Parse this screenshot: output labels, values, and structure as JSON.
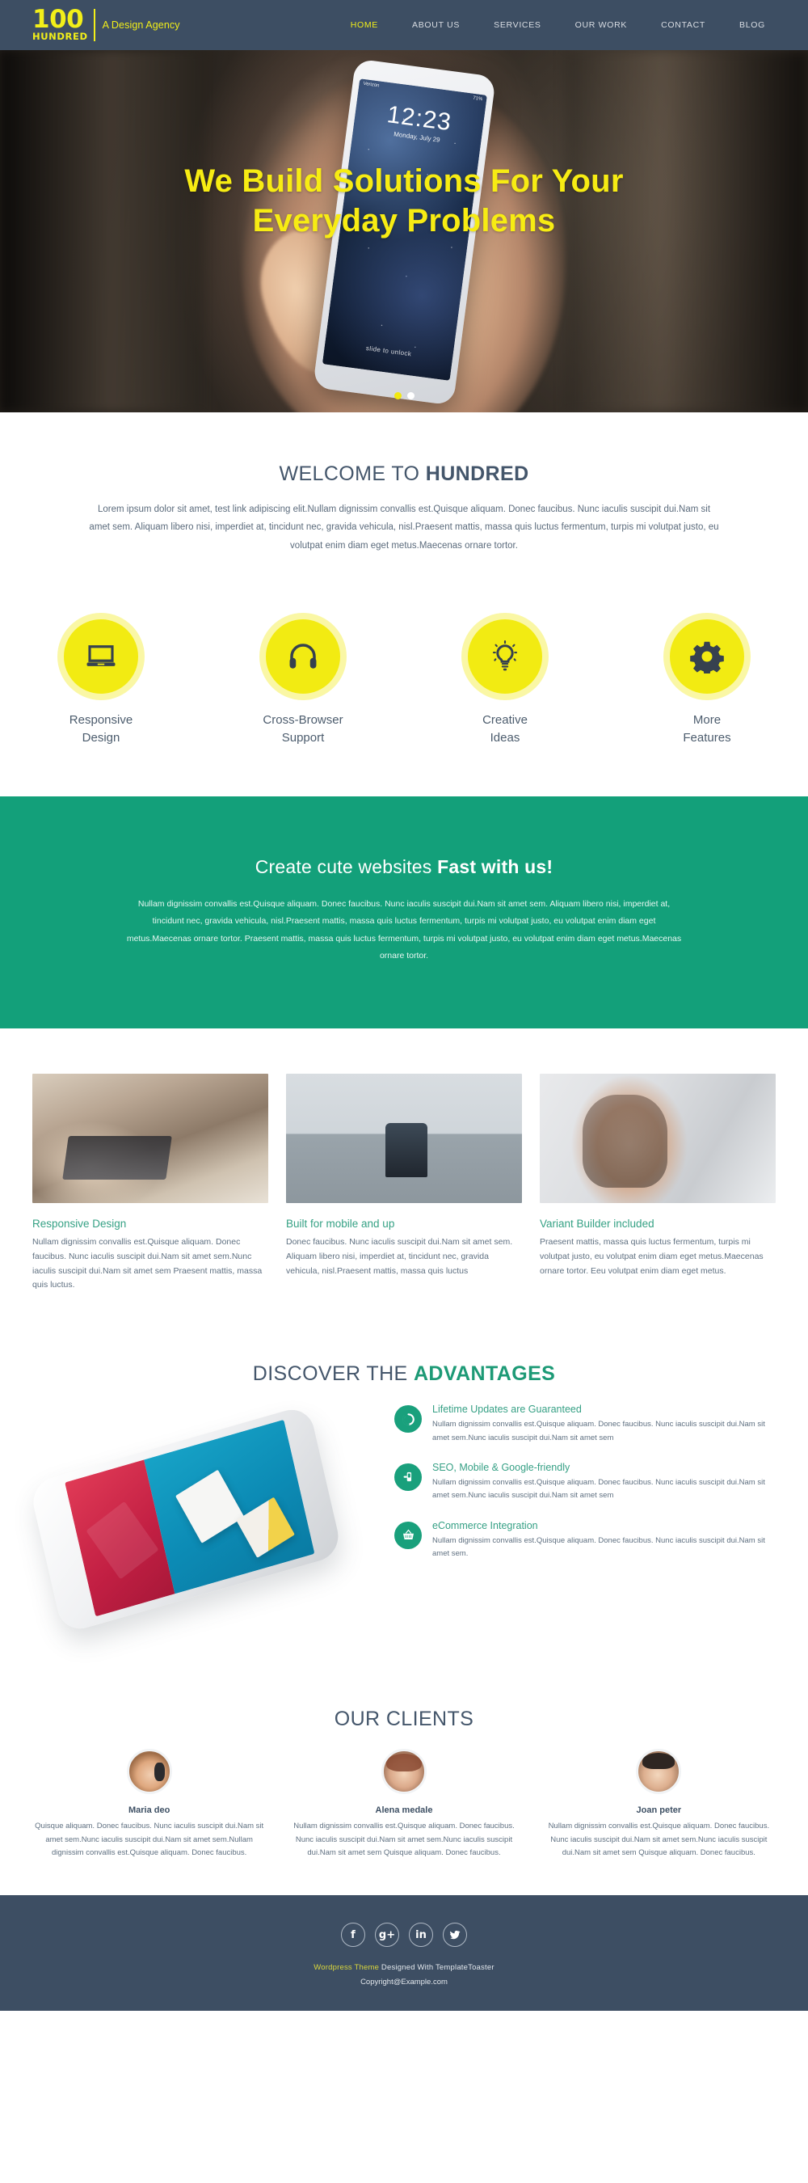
{
  "header": {
    "logo_number": "100",
    "logo_word": "HUNDRED",
    "tagline": "A Design Agency",
    "nav": [
      {
        "label": "HOME",
        "active": true
      },
      {
        "label": "ABOUT US",
        "active": false
      },
      {
        "label": "SERVICES",
        "active": false
      },
      {
        "label": "OUR WORK",
        "active": false
      },
      {
        "label": "CONTACT",
        "active": false
      },
      {
        "label": "BLOG",
        "active": false
      }
    ]
  },
  "hero": {
    "title_line1": "We Build Solutions For Your",
    "title_line2": "Everyday Problems",
    "phone": {
      "carrier": "Verizon",
      "time": "12:23",
      "date": "Monday, July 29",
      "battery": "71%",
      "unlock_text": "slide to unlock"
    },
    "dots": [
      {
        "active": true
      },
      {
        "active": false
      }
    ]
  },
  "welcome": {
    "title_normal": "WELCOME TO ",
    "title_bold": "HUNDRED",
    "copy": "Lorem ipsum dolor sit amet, test link adipiscing elit.Nullam dignissim convallis est.Quisque aliquam. Donec faucibus. Nunc iaculis suscipit dui.Nam sit amet sem. Aliquam libero nisi, imperdiet at, tincidunt nec, gravida vehicula, nisl.Praesent mattis, massa quis luctus fermentum, turpis mi volutpat justo, eu volutpat enim diam eget metus.Maecenas ornare tortor."
  },
  "features": [
    {
      "icon": "laptop-icon",
      "label_line1": "Responsive",
      "label_line2": "Design"
    },
    {
      "icon": "headphones-icon",
      "label_line1": "Cross-Browser",
      "label_line2": "Support"
    },
    {
      "icon": "lightbulb-icon",
      "label_line1": "Creative",
      "label_line2": "Ideas"
    },
    {
      "icon": "gear-icon",
      "label_line1": "More",
      "label_line2": "Features"
    }
  ],
  "cta": {
    "title_normal": "Create cute websites ",
    "title_bold": "Fast with us!",
    "copy": "Nullam dignissim convallis est.Quisque aliquam. Donec faucibus. Nunc iaculis suscipit dui.Nam sit amet sem. Aliquam libero nisi, imperdiet at, tincidunt nec, gravida vehicula, nisl.Praesent mattis, massa quis luctus fermentum, turpis mi volutpat justo, eu volutpat enim diam eget metus.Maecenas ornare tortor. Praesent mattis, massa quis luctus fermentum, turpis mi volutpat justo, eu volutpat enim diam eget metus.Maecenas ornare tortor."
  },
  "portfolio": [
    {
      "image": "laptop-workspace-photo",
      "title": "Responsive Design",
      "copy": "Nullam dignissim convallis est.Quisque aliquam. Donec faucibus. Nunc iaculis suscipit dui.Nam sit amet sem.Nunc iaculis suscipit dui.Nam sit amet sem Praesent mattis, massa quis luctus."
    },
    {
      "image": "man-sitting-wall-photo",
      "title": "Built for mobile and up",
      "copy": "Donec faucibus. Nunc iaculis suscipit dui.Nam sit amet sem. Aliquam libero nisi, imperdiet at, tincidunt nec, gravida vehicula, nisl.Praesent mattis, massa quis luctus"
    },
    {
      "image": "woman-with-phone-photo",
      "title": "Variant Builder included",
      "copy": "Praesent mattis, massa quis luctus fermentum, turpis mi volutpat justo, eu volutpat enim diam eget metus.Maecenas ornare tortor. Eeu volutpat enim diam eget metus."
    }
  ],
  "advantages": {
    "title_normal": "DISCOVER THE ",
    "title_accent": "ADVANTAGES",
    "visual": "tilted-iphone-mockup",
    "items": [
      {
        "icon": "refresh-icon",
        "title": "Lifetime Updates are Guaranteed",
        "copy": "Nullam dignissim convallis est.Quisque aliquam. Donec faucibus. Nunc iaculis suscipit dui.Nam sit amet sem.Nunc iaculis suscipit dui.Nam sit amet sem"
      },
      {
        "icon": "hand-pointer-icon",
        "title": "SEO, Mobile & Google-friendly",
        "copy": "Nullam dignissim convallis est.Quisque aliquam. Donec faucibus. Nunc iaculis suscipit dui.Nam sit amet sem.Nunc iaculis suscipit dui.Nam sit amet sem"
      },
      {
        "icon": "shopping-basket-icon",
        "title": "eCommerce Integration",
        "copy": "Nullam dignissim convallis est.Quisque aliquam. Donec faucibus. Nunc iaculis suscipit dui.Nam sit amet sem."
      }
    ]
  },
  "clients": {
    "title": "OUR CLIENTS",
    "items": [
      {
        "avatar": "woman-headset-avatar",
        "name": "Maria deo",
        "copy": "Quisque aliquam. Donec faucibus. Nunc iaculis suscipit dui.Nam sit amet sem.Nunc iaculis suscipit dui.Nam sit amet sem.Nullam dignissim convallis est.Quisque aliquam. Donec faucibus."
      },
      {
        "avatar": "red-haired-woman-avatar",
        "name": "Alena medale",
        "copy": "Nullam dignissim convallis est.Quisque aliquam. Donec faucibus. Nunc iaculis suscipit dui.Nam sit amet sem.Nunc iaculis suscipit dui.Nam sit amet sem Quisque aliquam. Donec faucibus."
      },
      {
        "avatar": "man-avatar",
        "name": "Joan peter",
        "copy": "Nullam dignissim convallis est.Quisque aliquam. Donec faucibus. Nunc iaculis suscipit dui.Nam sit amet sem.Nunc iaculis suscipit dui.Nam sit amet sem Quisque aliquam. Donec faucibus."
      }
    ]
  },
  "footer": {
    "social": [
      {
        "icon": "facebook-icon",
        "glyph": "f"
      },
      {
        "icon": "google-plus-icon",
        "glyph": "g+"
      },
      {
        "icon": "linkedin-icon",
        "glyph": "in"
      },
      {
        "icon": "twitter-icon",
        "glyph": ""
      }
    ],
    "credit_yellow": "Wordpress Theme",
    "credit_rest": " Designed With TemplateToaster",
    "copyright": "Copyright@Example.com"
  },
  "colors": {
    "navy": "#3d4e63",
    "yellow": "#f2eb12",
    "green": "#13a07a",
    "teal_text": "#36a085",
    "body_text": "#5f7081"
  }
}
